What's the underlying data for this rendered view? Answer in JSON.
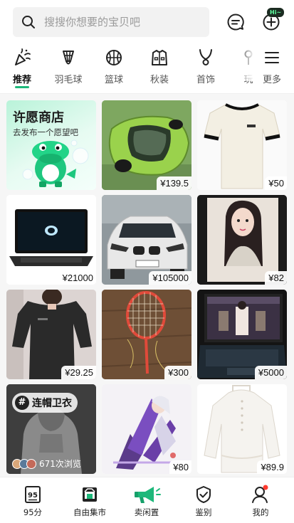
{
  "search": {
    "placeholder": "搜搜你想要的宝贝吧"
  },
  "header": {
    "badge": "Hi~"
  },
  "categories": [
    {
      "label": "推荐",
      "icon": "party-popper-icon",
      "active": true
    },
    {
      "label": "羽毛球",
      "icon": "shuttlecock-icon"
    },
    {
      "label": "篮球",
      "icon": "basketball-icon"
    },
    {
      "label": "秋装",
      "icon": "jacket-icon"
    },
    {
      "label": "首饰",
      "icon": "necklace-icon"
    },
    {
      "label": "玩",
      "icon": "toy-icon"
    }
  ],
  "more": {
    "label": "更多"
  },
  "wish_card": {
    "title": "许愿商店",
    "subtitle": "去发布一个愿望吧"
  },
  "products": [
    {
      "price": "¥139.5",
      "alt": "car-model"
    },
    {
      "price": "¥50",
      "alt": "t-shirt"
    },
    {
      "price": "¥21000",
      "alt": "laptop"
    },
    {
      "price": "¥105000",
      "alt": "bmw-car"
    },
    {
      "price": "¥82",
      "alt": "photo-card"
    },
    {
      "price": "¥29.25",
      "alt": "black-shirt"
    },
    {
      "price": "¥300",
      "alt": "badminton-racket"
    },
    {
      "price": "¥5000",
      "alt": "gaming-laptop"
    },
    {
      "price": "¥80",
      "alt": "anime-figure"
    },
    {
      "price": "¥89.9",
      "alt": "white-sweater"
    }
  ],
  "topic_card": {
    "hash": "#",
    "tag": "连帽卫衣",
    "views": "671次浏览"
  },
  "tabs": [
    {
      "label": "95分",
      "icon": "95-score-icon"
    },
    {
      "label": "自由集市",
      "icon": "market-icon"
    },
    {
      "label": "卖闲置",
      "icon": "megaphone-icon"
    },
    {
      "label": "鉴别",
      "icon": "shield-check-icon"
    },
    {
      "label": "我的",
      "icon": "profile-icon"
    }
  ],
  "colors": {
    "accent": "#1db87a",
    "badge_red": "#ff3b30"
  }
}
